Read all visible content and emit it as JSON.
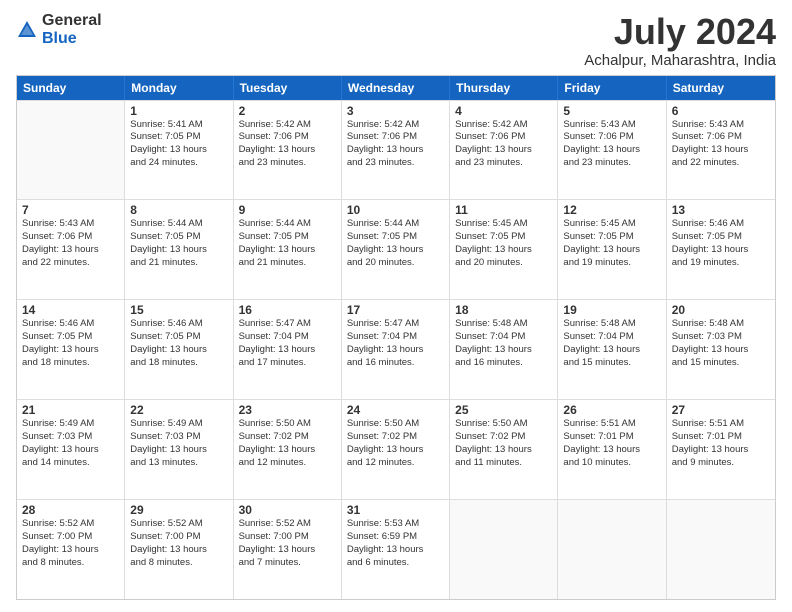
{
  "logo": {
    "general": "General",
    "blue": "Blue"
  },
  "title": "July 2024",
  "location": "Achalpur, Maharashtra, India",
  "headers": [
    "Sunday",
    "Monday",
    "Tuesday",
    "Wednesday",
    "Thursday",
    "Friday",
    "Saturday"
  ],
  "weeks": [
    [
      {
        "day": "",
        "info": ""
      },
      {
        "day": "1",
        "info": "Sunrise: 5:41 AM\nSunset: 7:05 PM\nDaylight: 13 hours\nand 24 minutes."
      },
      {
        "day": "2",
        "info": "Sunrise: 5:42 AM\nSunset: 7:06 PM\nDaylight: 13 hours\nand 23 minutes."
      },
      {
        "day": "3",
        "info": "Sunrise: 5:42 AM\nSunset: 7:06 PM\nDaylight: 13 hours\nand 23 minutes."
      },
      {
        "day": "4",
        "info": "Sunrise: 5:42 AM\nSunset: 7:06 PM\nDaylight: 13 hours\nand 23 minutes."
      },
      {
        "day": "5",
        "info": "Sunrise: 5:43 AM\nSunset: 7:06 PM\nDaylight: 13 hours\nand 23 minutes."
      },
      {
        "day": "6",
        "info": "Sunrise: 5:43 AM\nSunset: 7:06 PM\nDaylight: 13 hours\nand 22 minutes."
      }
    ],
    [
      {
        "day": "7",
        "info": "Sunrise: 5:43 AM\nSunset: 7:06 PM\nDaylight: 13 hours\nand 22 minutes."
      },
      {
        "day": "8",
        "info": "Sunrise: 5:44 AM\nSunset: 7:05 PM\nDaylight: 13 hours\nand 21 minutes."
      },
      {
        "day": "9",
        "info": "Sunrise: 5:44 AM\nSunset: 7:05 PM\nDaylight: 13 hours\nand 21 minutes."
      },
      {
        "day": "10",
        "info": "Sunrise: 5:44 AM\nSunset: 7:05 PM\nDaylight: 13 hours\nand 20 minutes."
      },
      {
        "day": "11",
        "info": "Sunrise: 5:45 AM\nSunset: 7:05 PM\nDaylight: 13 hours\nand 20 minutes."
      },
      {
        "day": "12",
        "info": "Sunrise: 5:45 AM\nSunset: 7:05 PM\nDaylight: 13 hours\nand 19 minutes."
      },
      {
        "day": "13",
        "info": "Sunrise: 5:46 AM\nSunset: 7:05 PM\nDaylight: 13 hours\nand 19 minutes."
      }
    ],
    [
      {
        "day": "14",
        "info": "Sunrise: 5:46 AM\nSunset: 7:05 PM\nDaylight: 13 hours\nand 18 minutes."
      },
      {
        "day": "15",
        "info": "Sunrise: 5:46 AM\nSunset: 7:05 PM\nDaylight: 13 hours\nand 18 minutes."
      },
      {
        "day": "16",
        "info": "Sunrise: 5:47 AM\nSunset: 7:04 PM\nDaylight: 13 hours\nand 17 minutes."
      },
      {
        "day": "17",
        "info": "Sunrise: 5:47 AM\nSunset: 7:04 PM\nDaylight: 13 hours\nand 16 minutes."
      },
      {
        "day": "18",
        "info": "Sunrise: 5:48 AM\nSunset: 7:04 PM\nDaylight: 13 hours\nand 16 minutes."
      },
      {
        "day": "19",
        "info": "Sunrise: 5:48 AM\nSunset: 7:04 PM\nDaylight: 13 hours\nand 15 minutes."
      },
      {
        "day": "20",
        "info": "Sunrise: 5:48 AM\nSunset: 7:03 PM\nDaylight: 13 hours\nand 15 minutes."
      }
    ],
    [
      {
        "day": "21",
        "info": "Sunrise: 5:49 AM\nSunset: 7:03 PM\nDaylight: 13 hours\nand 14 minutes."
      },
      {
        "day": "22",
        "info": "Sunrise: 5:49 AM\nSunset: 7:03 PM\nDaylight: 13 hours\nand 13 minutes."
      },
      {
        "day": "23",
        "info": "Sunrise: 5:50 AM\nSunset: 7:02 PM\nDaylight: 13 hours\nand 12 minutes."
      },
      {
        "day": "24",
        "info": "Sunrise: 5:50 AM\nSunset: 7:02 PM\nDaylight: 13 hours\nand 12 minutes."
      },
      {
        "day": "25",
        "info": "Sunrise: 5:50 AM\nSunset: 7:02 PM\nDaylight: 13 hours\nand 11 minutes."
      },
      {
        "day": "26",
        "info": "Sunrise: 5:51 AM\nSunset: 7:01 PM\nDaylight: 13 hours\nand 10 minutes."
      },
      {
        "day": "27",
        "info": "Sunrise: 5:51 AM\nSunset: 7:01 PM\nDaylight: 13 hours\nand 9 minutes."
      }
    ],
    [
      {
        "day": "28",
        "info": "Sunrise: 5:52 AM\nSunset: 7:00 PM\nDaylight: 13 hours\nand 8 minutes."
      },
      {
        "day": "29",
        "info": "Sunrise: 5:52 AM\nSunset: 7:00 PM\nDaylight: 13 hours\nand 8 minutes."
      },
      {
        "day": "30",
        "info": "Sunrise: 5:52 AM\nSunset: 7:00 PM\nDaylight: 13 hours\nand 7 minutes."
      },
      {
        "day": "31",
        "info": "Sunrise: 5:53 AM\nSunset: 6:59 PM\nDaylight: 13 hours\nand 6 minutes."
      },
      {
        "day": "",
        "info": ""
      },
      {
        "day": "",
        "info": ""
      },
      {
        "day": "",
        "info": ""
      }
    ]
  ]
}
